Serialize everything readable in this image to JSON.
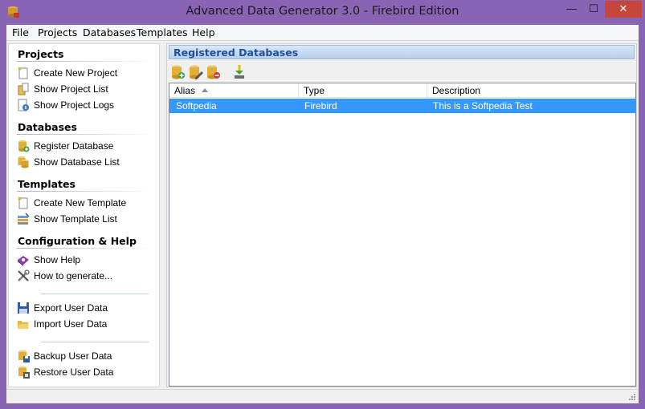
{
  "window": {
    "title": "Advanced Data Generator 3.0 - Firebird Edition",
    "minimize_glyph": "—",
    "maximize_glyph": "☐",
    "close_glyph": "✕"
  },
  "menu": [
    "File",
    "Projects",
    "Databases",
    "Templates",
    "Help"
  ],
  "sidebar": {
    "sections": [
      {
        "title": "Projects",
        "items": [
          {
            "label": "Create New Project",
            "icon": "new-document-icon"
          },
          {
            "label": "Show Project List",
            "icon": "project-list-icon"
          },
          {
            "label": "Show Project Logs",
            "icon": "project-log-icon"
          }
        ]
      },
      {
        "title": "Databases",
        "items": [
          {
            "label": "Register Database",
            "icon": "database-add-icon"
          },
          {
            "label": "Show Database List",
            "icon": "database-list-icon"
          }
        ]
      },
      {
        "title": "Templates",
        "items": [
          {
            "label": "Create  New Template",
            "icon": "new-template-icon"
          },
          {
            "label": "Show Template List",
            "icon": "template-list-icon"
          }
        ]
      },
      {
        "title": "Configuration & Help",
        "items": [
          {
            "label": "Show Help",
            "icon": "help-book-icon"
          },
          {
            "label": "How to generate...",
            "icon": "tools-icon"
          }
        ]
      }
    ],
    "extra_items": [
      {
        "label": "Export User Data",
        "icon": "save-icon"
      },
      {
        "label": "Import User Data",
        "icon": "open-folder-icon"
      },
      {
        "label": "Backup User Data",
        "icon": "backup-icon"
      },
      {
        "label": "Restore User Data",
        "icon": "restore-icon"
      }
    ]
  },
  "panel": {
    "title": "Registered Databases",
    "toolbar": [
      "add-database-icon",
      "edit-database-icon",
      "remove-database-icon",
      "import-database-icon"
    ]
  },
  "grid": {
    "columns": [
      "Alias",
      "Type",
      "Description"
    ],
    "sort_column": "Alias",
    "rows": [
      {
        "alias": "Softpedia",
        "type": "Firebird",
        "description": "This is a Softpedia Test",
        "selected": true
      }
    ]
  },
  "colors": {
    "window_frame": "#8a64b4",
    "close_button": "#c7463c",
    "selection": "#3399ff",
    "panel_header_text": "#1f4f9a"
  }
}
